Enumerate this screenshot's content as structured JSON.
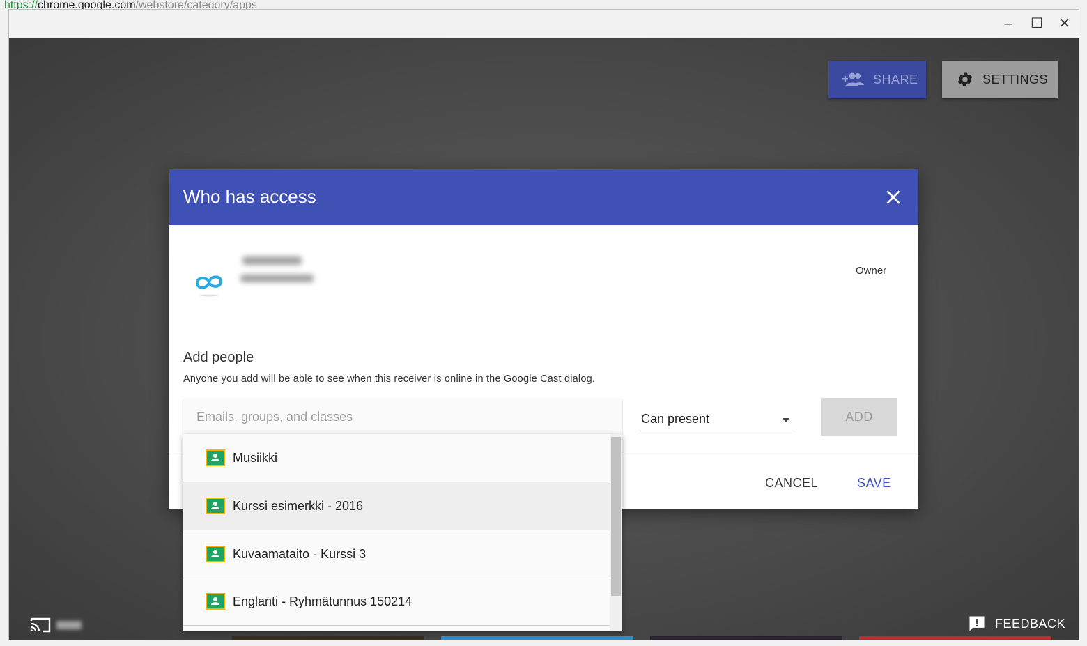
{
  "browser": {
    "url_scheme": "https://",
    "url_host": "chrome.google.com",
    "url_path": "/webstore/category/apps"
  },
  "window_controls": {
    "minimize_label": "–",
    "maximize_label": "☐",
    "close_label": "✕"
  },
  "toolbar": {
    "share_label": "SHARE",
    "settings_label": "SETTINGS"
  },
  "footer": {
    "feedback_label": "FEEDBACK"
  },
  "dialog": {
    "title": "Who has access",
    "owner_role": "Owner",
    "add_people_title": "Add people",
    "add_people_desc": "Anyone you add will be able to see when this receiver is online in the Google Cast dialog.",
    "search_placeholder": "Emails, groups, and classes",
    "permission_value": "Can present",
    "add_label": "ADD",
    "cancel_label": "CANCEL",
    "save_label": "SAVE"
  },
  "suggestions": [
    {
      "label": "Musiikki",
      "icon": "classroom-icon"
    },
    {
      "label": "Kurssi esimerkki - 2016",
      "icon": "classroom-icon"
    },
    {
      "label": "Kuvaamataito - Kurssi 3",
      "icon": "classroom-icon"
    },
    {
      "label": "Englanti - Ryhmätunnus 150214",
      "icon": "classroom-icon"
    }
  ],
  "colors": {
    "dialog_header": "#3f51b5",
    "share_button": "#3b4aa0",
    "settings_button": "#9c9c9c",
    "classroom_green": "#1fa463",
    "classroom_yellow": "#f4b400"
  }
}
